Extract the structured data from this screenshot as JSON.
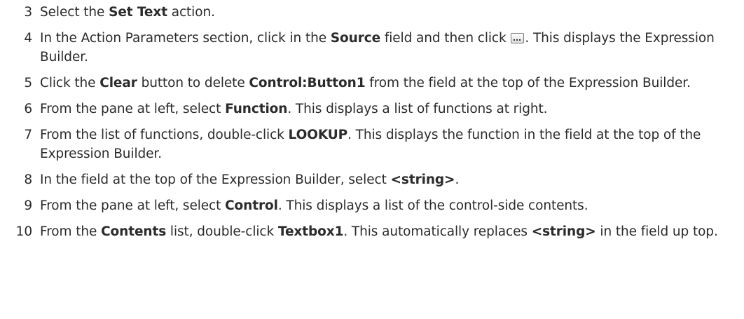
{
  "steps": [
    {
      "number": "3",
      "parts": [
        {
          "t": "Select the "
        },
        {
          "t": "Set Text",
          "b": true
        },
        {
          "t": " action."
        }
      ]
    },
    {
      "number": "4",
      "parts": [
        {
          "t": "In the Action Parameters section, click in the "
        },
        {
          "t": "Source",
          "b": true
        },
        {
          "t": " field and then click "
        },
        {
          "icon": "ellipsis-button-icon"
        },
        {
          "t": ". This displays the Expression Builder."
        }
      ]
    },
    {
      "number": "5",
      "parts": [
        {
          "t": "Click the "
        },
        {
          "t": "Clear",
          "b": true
        },
        {
          "t": " button to delete "
        },
        {
          "t": "Control:Button1",
          "b": true
        },
        {
          "t": " from the field at the top of the Expression Builder."
        }
      ]
    },
    {
      "number": "6",
      "parts": [
        {
          "t": "From the pane at left, select "
        },
        {
          "t": "Function",
          "b": true
        },
        {
          "t": ". This displays a list of functions at right."
        }
      ]
    },
    {
      "number": "7",
      "parts": [
        {
          "t": "From the list of functions, double-click "
        },
        {
          "t": "LOOKUP",
          "b": true
        },
        {
          "t": ". This displays the function in the field at the top of the Expression Builder."
        }
      ]
    },
    {
      "number": "8",
      "parts": [
        {
          "t": "In the field at the top of the Expression Builder, select "
        },
        {
          "t": "<string>",
          "b": true
        },
        {
          "t": "."
        }
      ]
    },
    {
      "number": "9",
      "parts": [
        {
          "t": "From the pane at left, select "
        },
        {
          "t": "Control",
          "b": true
        },
        {
          "t": ". This displays a list of the control-side contents."
        }
      ]
    },
    {
      "number": "10",
      "parts": [
        {
          "t": "From the "
        },
        {
          "t": "Contents",
          "b": true
        },
        {
          "t": " list, double-click "
        },
        {
          "t": "Textbox1",
          "b": true
        },
        {
          "t": ". This automatically replaces "
        },
        {
          "t": "<string>",
          "b": true
        },
        {
          "t": " in the field up top."
        }
      ]
    }
  ]
}
